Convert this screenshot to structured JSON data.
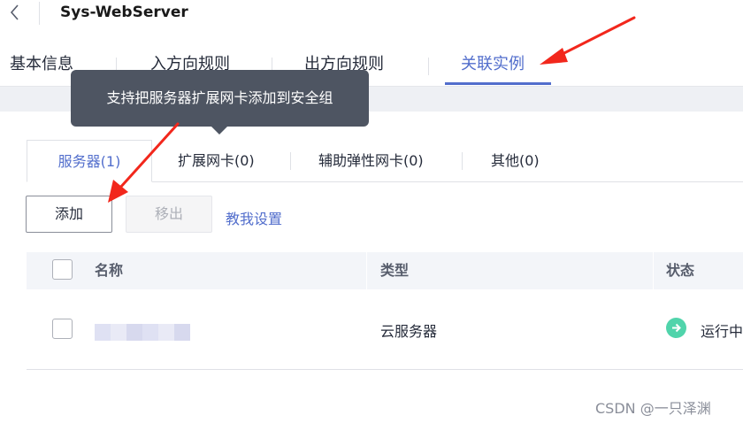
{
  "header": {
    "title": "Sys-WebServer",
    "back_icon": "chevron-left-icon"
  },
  "top_tabs": [
    {
      "label": "基本信息",
      "active": false
    },
    {
      "label": "入方向规则",
      "active": false
    },
    {
      "label": "出方向规则",
      "active": false
    },
    {
      "label": "关联实例",
      "active": true
    }
  ],
  "tooltip": {
    "text": "支持把服务器扩展网卡添加到安全组"
  },
  "sub_tabs": [
    {
      "label": "服务器(1)",
      "active": true
    },
    {
      "label": "扩展网卡(0)",
      "active": false
    },
    {
      "label": "辅助弹性网卡(0)",
      "active": false
    },
    {
      "label": "其他(0)",
      "active": false
    }
  ],
  "toolbar": {
    "add_label": "添加",
    "remove_label": "移出",
    "help_link": "教我设置"
  },
  "table": {
    "columns": [
      "名称",
      "类型",
      "状态"
    ],
    "rows": [
      {
        "name": "",
        "type": "云服务器",
        "status": "运行中",
        "status_icon": "arrow-right-circle-icon"
      }
    ]
  },
  "colors": {
    "accent": "#526ecc",
    "annotation_arrow": "#f2271c",
    "status_running": "#50d4ab",
    "tooltip_bg": "#4e5562"
  },
  "watermark": "CSDN @一只泽渊"
}
